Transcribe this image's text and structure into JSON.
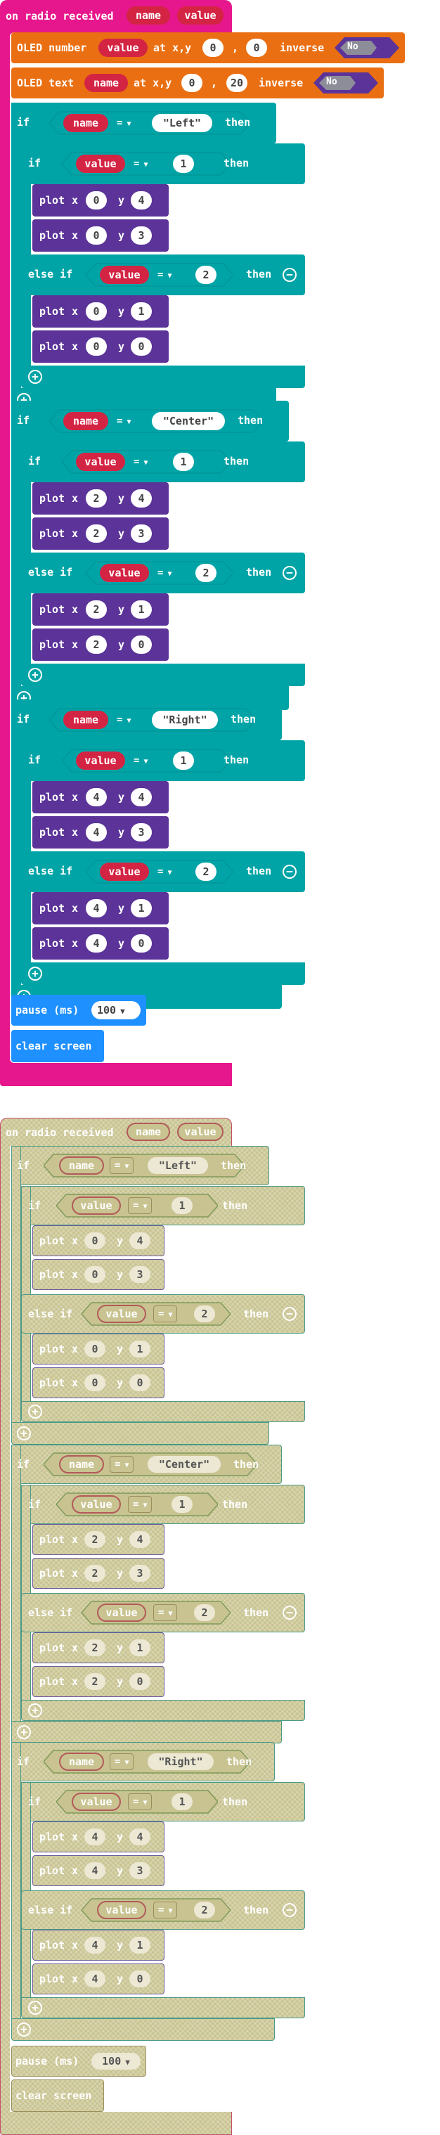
{
  "active": {
    "event": {
      "label": "on radio received",
      "params": [
        "name",
        "value"
      ]
    },
    "oled_number": {
      "label": "OLED number",
      "var": "value",
      "at": "at x,y",
      "x": "0",
      "comma": ",",
      "y": "0",
      "inverse": "inverse",
      "toggle": "No"
    },
    "oled_text": {
      "label": "OLED text",
      "var": "name",
      "at": "at x,y",
      "x": "0",
      "comma": ",",
      "y": "20",
      "inverse": "inverse",
      "toggle": "No"
    },
    "groups": [
      {
        "if": "if",
        "var": "name",
        "op": "=",
        "str": "\"Left\"",
        "then": "then",
        "inner_if": "if",
        "inner_var": "value",
        "inner_val": "1",
        "plots1": [
          [
            "0",
            "4"
          ],
          [
            "0",
            "3"
          ]
        ],
        "elseif": "else if",
        "elseif_var": "value",
        "elseif_val": "2",
        "plots2": [
          [
            "0",
            "1"
          ],
          [
            "0",
            "0"
          ]
        ]
      },
      {
        "if": "if",
        "var": "name",
        "op": "=",
        "str": "\"Center\"",
        "then": "then",
        "inner_if": "if",
        "inner_var": "value",
        "inner_val": "1",
        "plots1": [
          [
            "2",
            "4"
          ],
          [
            "2",
            "3"
          ]
        ],
        "elseif": "else if",
        "elseif_var": "value",
        "elseif_val": "2",
        "plots2": [
          [
            "2",
            "1"
          ],
          [
            "2",
            "0"
          ]
        ]
      },
      {
        "if": "if",
        "var": "name",
        "op": "=",
        "str": "\"Right\"",
        "then": "then",
        "inner_if": "if",
        "inner_var": "value",
        "inner_val": "1",
        "plots1": [
          [
            "4",
            "4"
          ],
          [
            "4",
            "3"
          ]
        ],
        "elseif": "else if",
        "elseif_var": "value",
        "elseif_val": "2",
        "plots2": [
          [
            "4",
            "1"
          ],
          [
            "4",
            "0"
          ]
        ]
      }
    ],
    "plot": {
      "label": "plot",
      "x": "x",
      "y": "y"
    },
    "pause": {
      "label": "pause (ms)",
      "value": "100"
    },
    "clear": {
      "label": "clear screen"
    }
  },
  "disabled": {
    "event": {
      "label": "on radio received",
      "params": [
        "name",
        "value"
      ]
    },
    "groups": [
      {
        "if": "if",
        "var": "name",
        "op": "=",
        "str": "\"Left\"",
        "then": "then",
        "inner_if": "if",
        "inner_var": "value",
        "inner_val": "1",
        "plots1": [
          [
            "0",
            "4"
          ],
          [
            "0",
            "3"
          ]
        ],
        "elseif": "else if",
        "elseif_var": "value",
        "elseif_val": "2",
        "plots2": [
          [
            "0",
            "1"
          ],
          [
            "0",
            "0"
          ]
        ]
      },
      {
        "if": "if",
        "var": "name",
        "op": "=",
        "str": "\"Center\"",
        "then": "then",
        "inner_if": "if",
        "inner_var": "value",
        "inner_val": "1",
        "plots1": [
          [
            "2",
            "4"
          ],
          [
            "2",
            "3"
          ]
        ],
        "elseif": "else if",
        "elseif_var": "value",
        "elseif_val": "2",
        "plots2": [
          [
            "2",
            "1"
          ],
          [
            "2",
            "0"
          ]
        ]
      },
      {
        "if": "if",
        "var": "name",
        "op": "=",
        "str": "\"Right\"",
        "then": "then",
        "inner_if": "if",
        "inner_var": "value",
        "inner_val": "1",
        "plots1": [
          [
            "4",
            "4"
          ],
          [
            "4",
            "3"
          ]
        ],
        "elseif": "else if",
        "elseif_var": "value",
        "elseif_val": "2",
        "plots2": [
          [
            "4",
            "1"
          ],
          [
            "4",
            "0"
          ]
        ]
      }
    ],
    "plot": {
      "label": "plot",
      "x": "x",
      "y": "y"
    },
    "pause": {
      "label": "pause (ms)",
      "value": "100"
    },
    "clear": {
      "label": "clear screen"
    }
  },
  "colors": {
    "event": "#e6168c",
    "oled": "#ea6f12",
    "logic": "#00a4a6",
    "plot": "#5b3399",
    "basic": "#1e90ff",
    "variable": "#d42443",
    "disabled": "#c8c390"
  },
  "icons": {
    "add": "plus-circle-icon",
    "remove": "minus-circle-icon",
    "dropdown": "caret-down-icon"
  }
}
